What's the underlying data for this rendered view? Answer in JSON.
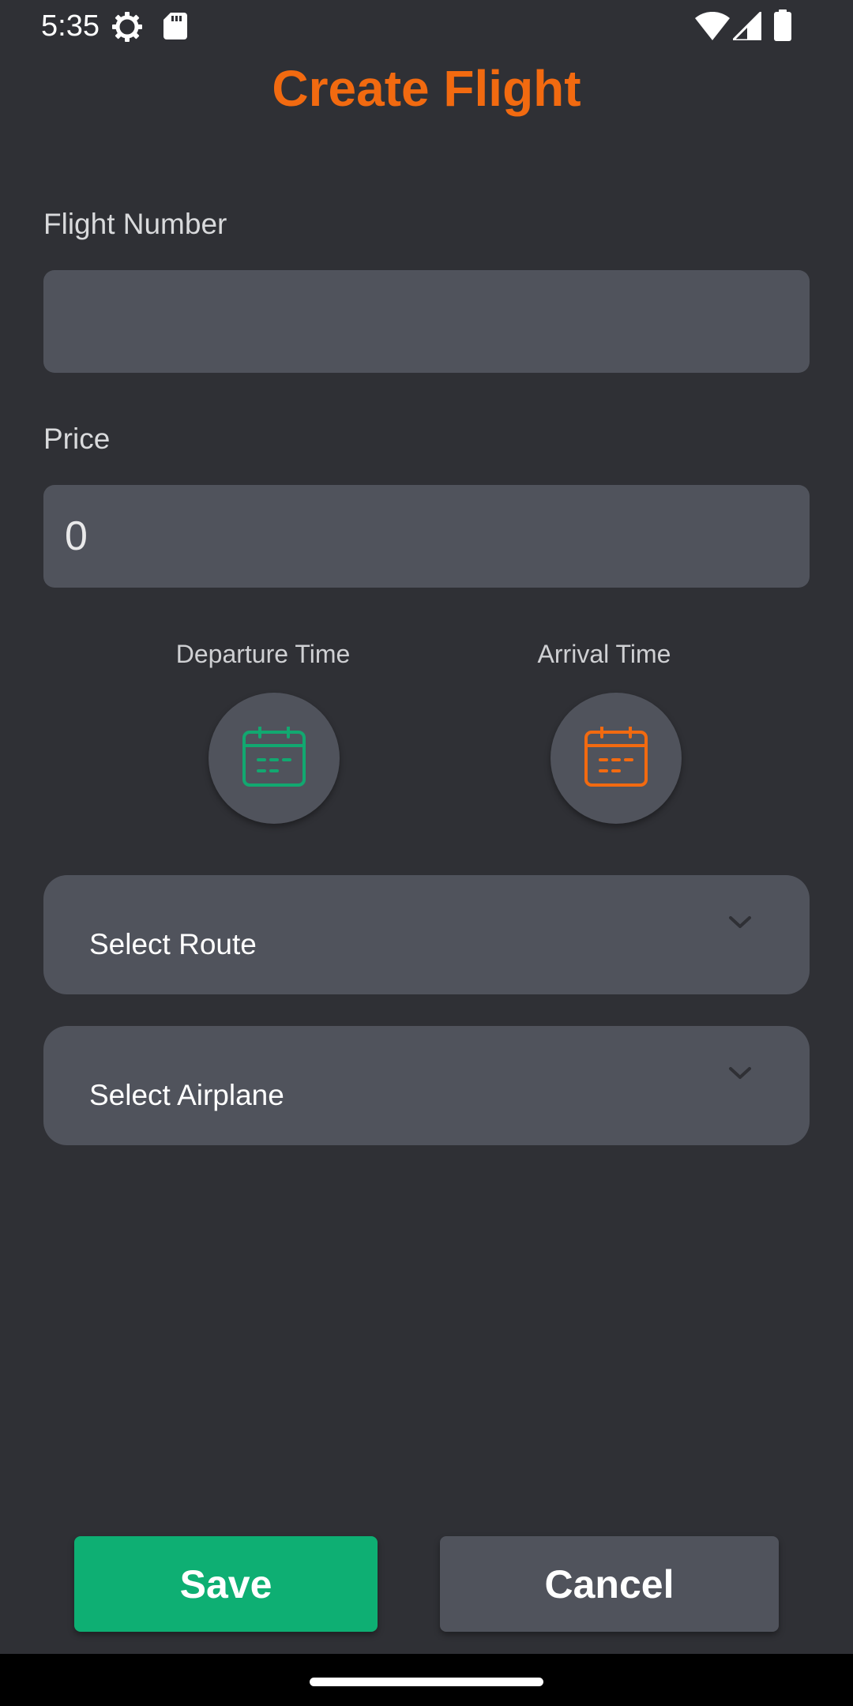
{
  "status_bar": {
    "time": "5:35",
    "icons": [
      "gear-icon",
      "sd-card-icon",
      "wifi-icon",
      "signal-icon",
      "battery-icon"
    ]
  },
  "title": "Create Flight",
  "flight_number": {
    "label": "Flight Number",
    "value": ""
  },
  "price": {
    "label": "Price",
    "value": "0"
  },
  "departure": {
    "label": "Departure Time",
    "icon": "calendar-icon",
    "color": "#12a870"
  },
  "arrival": {
    "label": "Arrival Time",
    "icon": "calendar-icon",
    "color": "#f26a10"
  },
  "route_select": {
    "selected": "Select Route"
  },
  "airplane_select": {
    "selected": "Select Airplane"
  },
  "actions": {
    "save_label": "Save",
    "cancel_label": "Cancel"
  },
  "colors": {
    "accent": "#f26a10",
    "primary_button": "#0eaf73",
    "background": "#2f3035",
    "field": "#50535c"
  }
}
